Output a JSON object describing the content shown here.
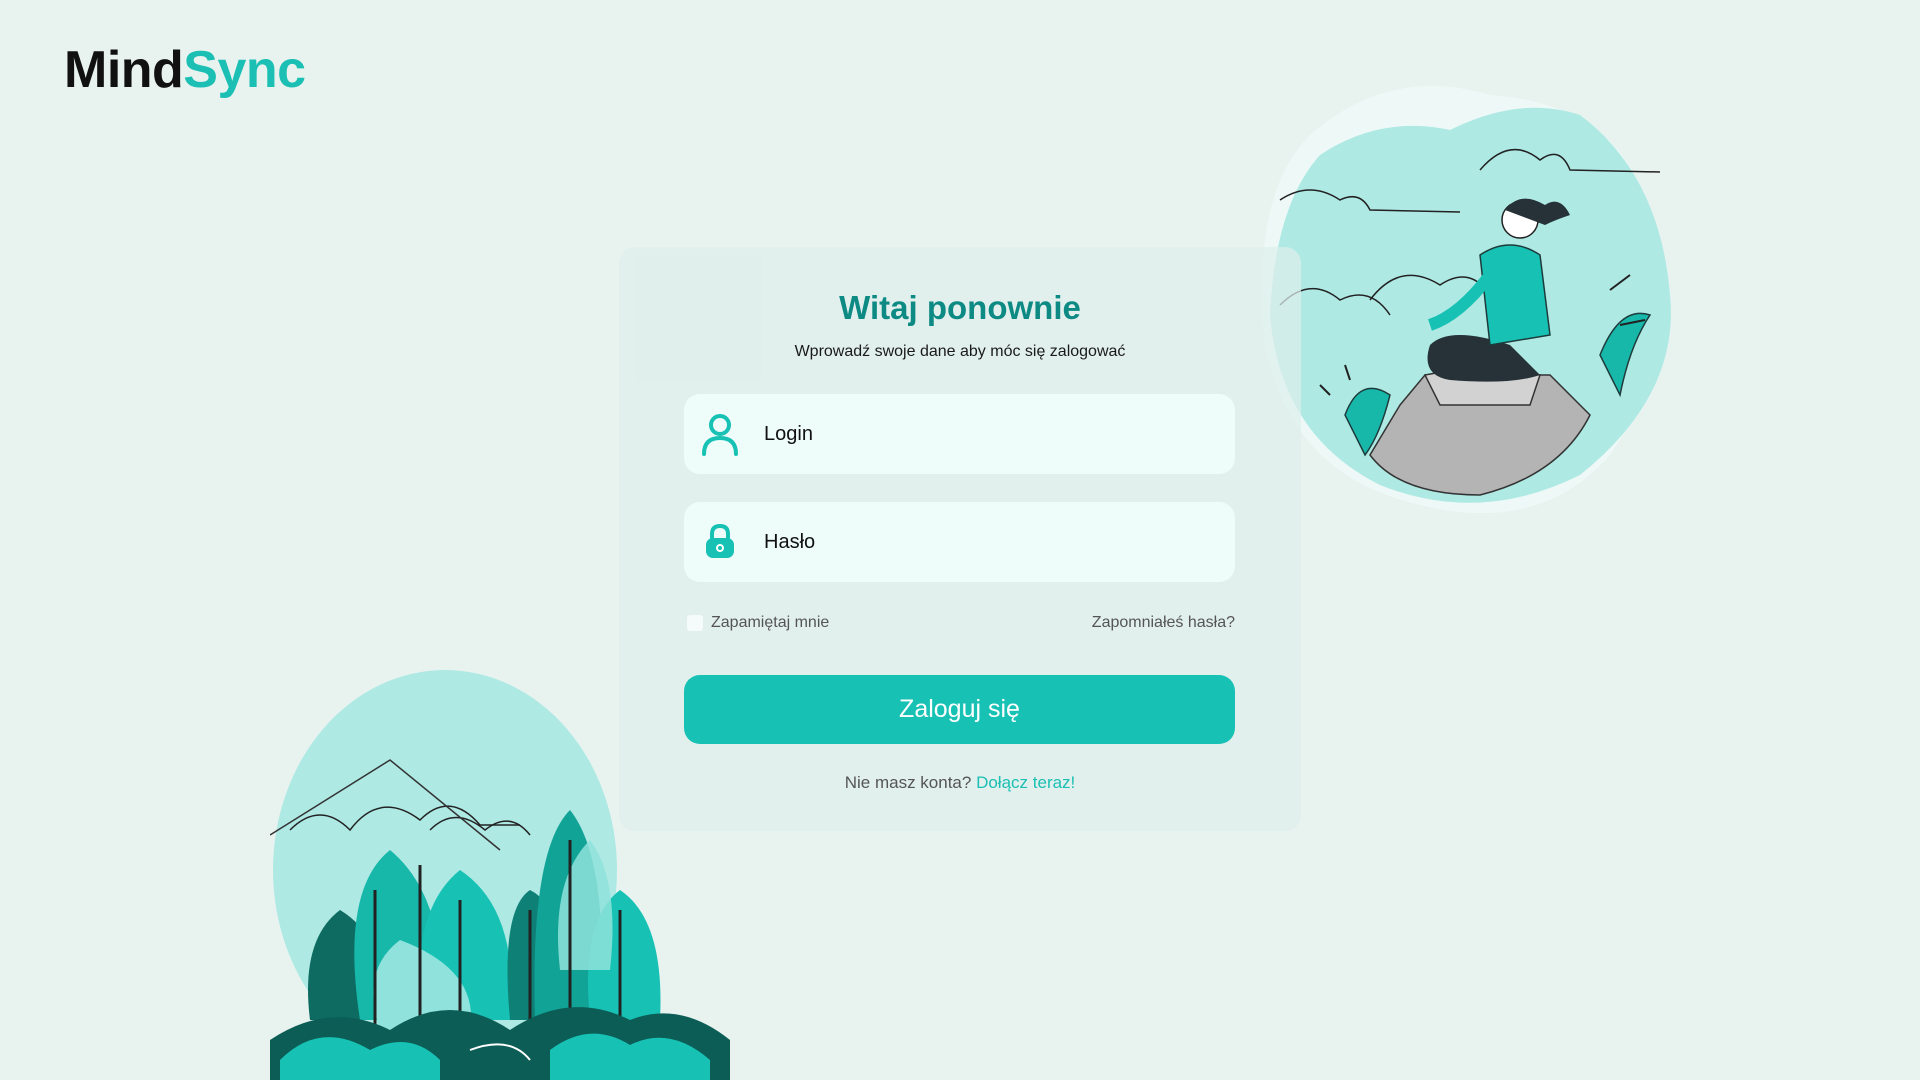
{
  "brand": {
    "part1": "Mind",
    "part2": "Sync"
  },
  "card": {
    "title": "Witaj ponownie",
    "subtitle": "Wprowadź swoje dane aby móc się zalogować",
    "login_placeholder": "Login",
    "password_placeholder": "Hasło",
    "remember_label": "Zapamiętaj mnie",
    "forgot_label": "Zapomniałeś hasła?",
    "submit_label": "Zaloguj się",
    "signup_prompt": "Nie masz konta?",
    "signup_link": "Dołącz teraz!"
  },
  "icons": {
    "login": "user-icon",
    "password": "lock-icon"
  },
  "colors": {
    "accent": "#17c2b5",
    "title": "#0e8a84",
    "background": "#e8f3f0",
    "field": "#eefcfa"
  }
}
